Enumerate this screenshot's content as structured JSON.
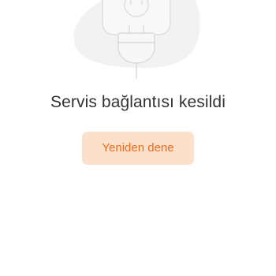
{
  "error_state": {
    "illustration_icon": "unplugged-power-plug-icon",
    "message": "Servis bağlantısı kesildi",
    "retry_label": "Yeniden dene"
  },
  "colors": {
    "background": "#ffffff",
    "illustration_blob": "#f2f2f2",
    "illustration_stroke": "#d9d9d9",
    "message_text": "#333333",
    "button_background": "#fbe0cc",
    "button_text": "#ef6c1c"
  }
}
